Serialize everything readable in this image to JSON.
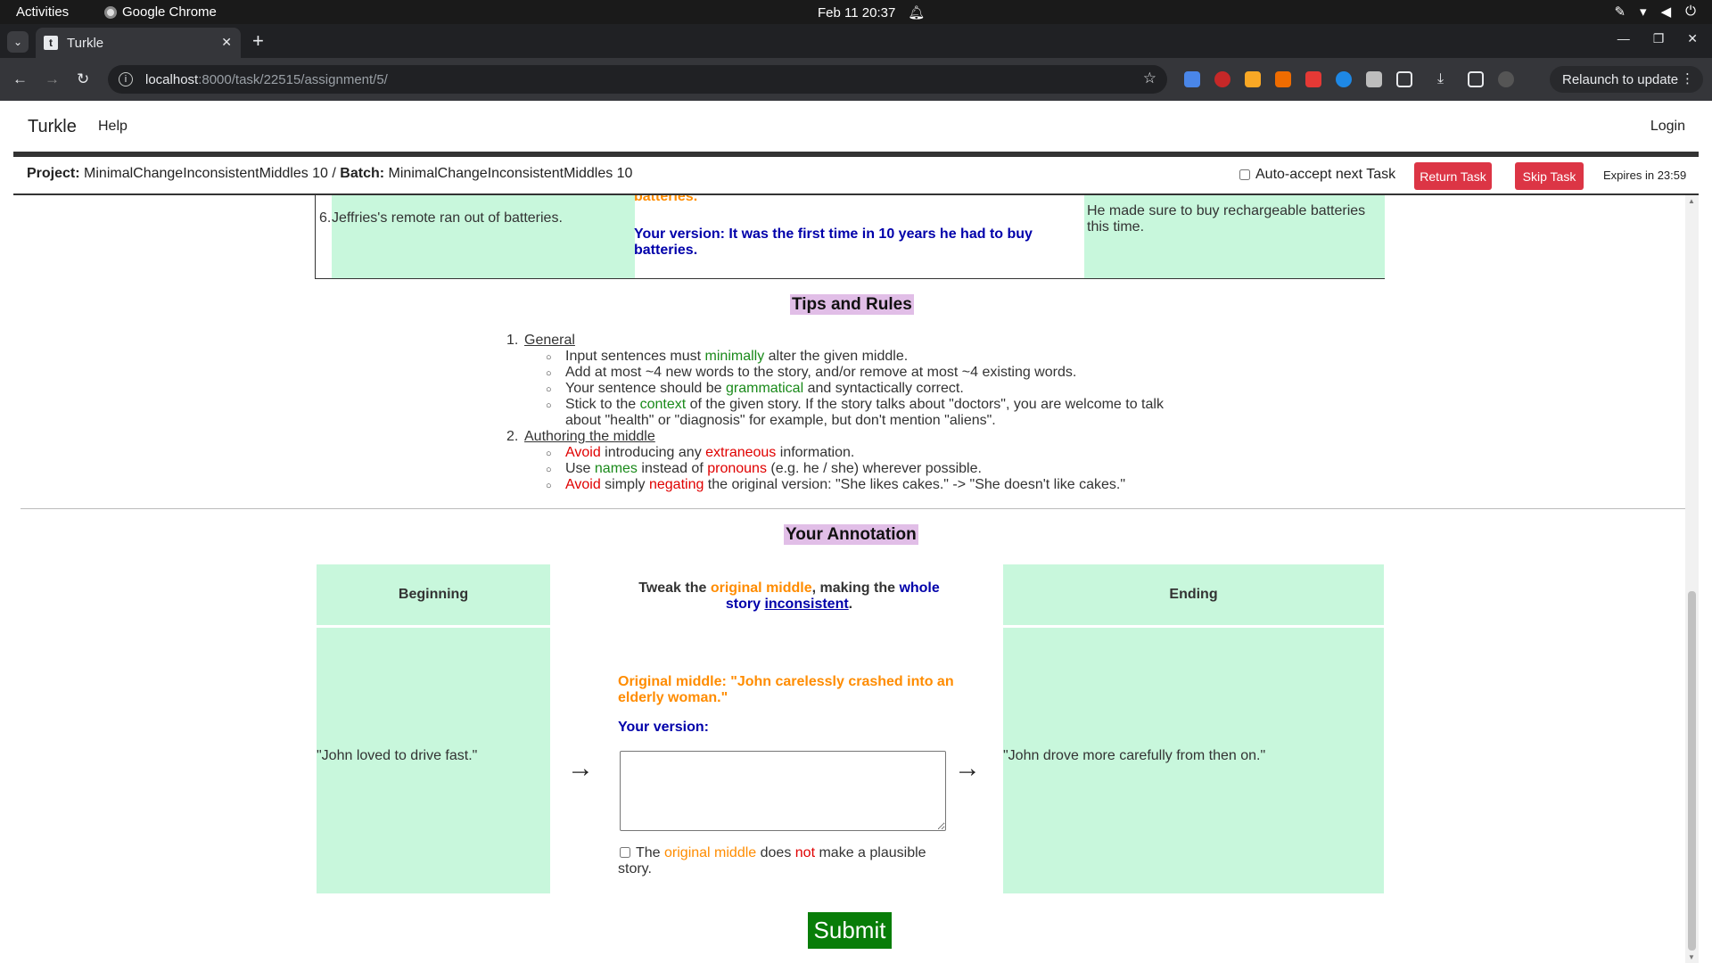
{
  "os": {
    "activities": "Activities",
    "app_name": "Google Chrome",
    "clock": "Feb 11  20:37"
  },
  "browser": {
    "tab_title": "Turkle",
    "tab_favicon": "t",
    "url_host": "localhost",
    "url_path": ":8000/task/22515/assignment/5/",
    "relaunch_label": "Relaunch to update"
  },
  "header": {
    "brand": "Turkle",
    "help": "Help",
    "login": "Login"
  },
  "project_bar": {
    "project_label": "Project:",
    "project_name": "MinimalChangeInconsistentMiddles 10",
    "separator": " / ",
    "batch_label": "Batch:",
    "batch_name": "MinimalChangeInconsistentMiddles 10",
    "auto_accept_label": "Auto-accept next Task",
    "return_label": "Return Task",
    "skip_label": "Skip Task",
    "expires": "Expires in 23:59"
  },
  "example": {
    "number": "6.",
    "beginning": "Jeffries's remote ran out of batteries.",
    "original_tail": "batteries.",
    "version": "Your version: It was the first time in 10 years he had to buy batteries.",
    "ending": "He made sure to buy rechargeable batteries this time."
  },
  "tips": {
    "title": "Tips and Rules",
    "sec1_num": "1.",
    "sec1_title": "General",
    "g1_a": "Input sentences must ",
    "g1_b": "minimally",
    "g1_c": " alter the given middle.",
    "g2": "Add at most ~4 new words to the story, and/or remove at most ~4 existing words.",
    "g3_a": "Your sentence should be ",
    "g3_b": "grammatical",
    "g3_c": " and syntactically correct.",
    "g4_a": "Stick to the ",
    "g4_b": "context",
    "g4_c": " of the given story. If the story talks about \"doctors\", you are welcome to talk about \"health\" or \"diagnosis\" for example, but don't mention \"aliens\".",
    "sec2_num": "2.",
    "sec2_title": "Authoring the middle",
    "a1_a": "Avoid",
    "a1_b": " introducing any ",
    "a1_c": "extraneous",
    "a1_d": " information.",
    "a2_a": "Use ",
    "a2_b": "names",
    "a2_c": " instead of ",
    "a2_d": "pronouns",
    "a2_e": " (e.g. he / she) wherever possible.",
    "a3_a": "Avoid",
    "a3_b": " simply ",
    "a3_c": "negating",
    "a3_d": " the original version: \"She likes cakes.\" -> \"She doesn't like cakes.\""
  },
  "annotation": {
    "title": "Your Annotation",
    "beginning_header": "Beginning",
    "ending_header": "Ending",
    "beginning_text": "\"John loved to drive fast.\"",
    "ending_text": "\"John drove more carefully from then on.\"",
    "instr_a": "Tweak the ",
    "instr_b": "original middle",
    "instr_c": ", making the ",
    "instr_d": "whole story ",
    "instr_e": "inconsistent",
    "instr_f": ".",
    "original_middle": "Original middle: \"John carelessly crashed into an elderly woman.\"",
    "your_version_label": "Your version:",
    "your_version_value": "",
    "implausible_a": "The ",
    "implausible_b": "original middle",
    "implausible_c": " does ",
    "implausible_d": "not",
    "implausible_e": " make a plausible story.",
    "arrow": "→",
    "submit": "Submit"
  },
  "colors": {
    "cell_green": "#c8f7dc",
    "heading_purple": "#e1bee7",
    "orange": "#ff8c00",
    "blue": "#0000aa",
    "red": "#e00000",
    "green_text": "#1a8a1a",
    "submit_green": "#087d08",
    "button_red": "#dc3545"
  }
}
